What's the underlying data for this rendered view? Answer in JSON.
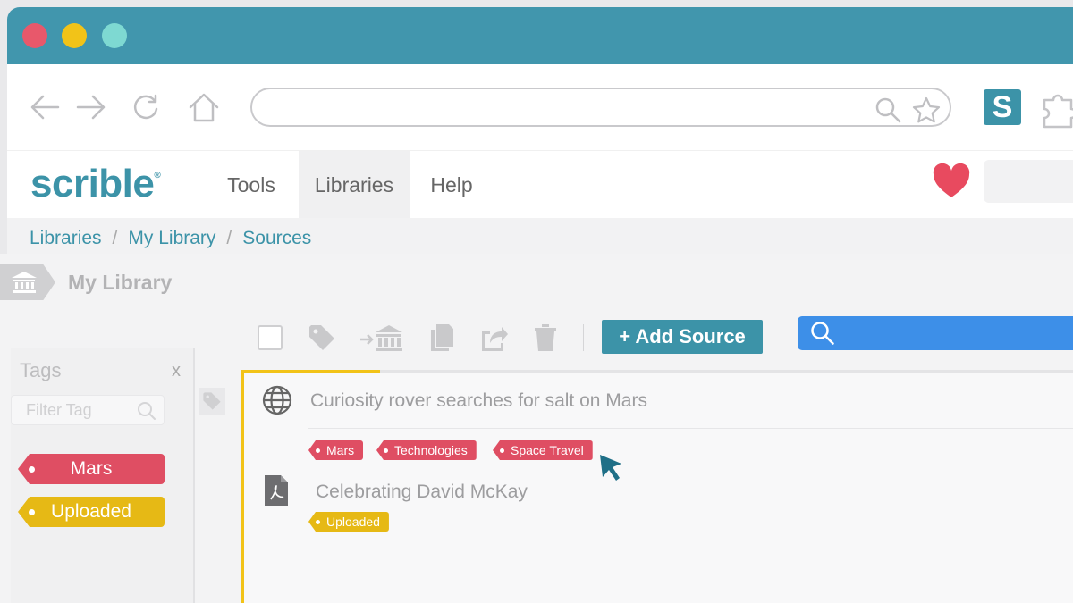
{
  "browser": {
    "colors": {
      "titlebar": "#4196ad",
      "close": "#e8586b",
      "minimize": "#f2c318",
      "maximize": "#7ed9d2"
    },
    "nav": {
      "back_icon": "arrow-left-icon",
      "forward_icon": "arrow-right-icon",
      "reload_icon": "reload-icon",
      "home_icon": "home-icon"
    },
    "address_bar": {
      "value": "",
      "search_icon": "search-icon",
      "star_icon": "star-icon"
    },
    "extensions": {
      "scrible_letter": "S",
      "puzzle_icon": "puzzle-icon"
    }
  },
  "app": {
    "logo": "scrible",
    "logo_mark": "®",
    "brand_color": "#3c93a8",
    "menu": {
      "tools": "Tools",
      "libraries": "Libraries",
      "help": "Help"
    },
    "heart_color": "#e84a5f"
  },
  "breadcrumb": {
    "items": [
      "Libraries",
      "My Library",
      "Sources"
    ],
    "separator": "/"
  },
  "library": {
    "title": "My Library",
    "icon": "bank-icon"
  },
  "actions": {
    "add_source": "+ Add Source",
    "icons": [
      "select-all-checkbox",
      "tag-icon",
      "move-to-library-icon",
      "copy-icon",
      "share-icon",
      "trash-icon"
    ]
  },
  "tags_panel": {
    "title": "Tags",
    "close": "x",
    "filter_placeholder": "Filter Tag",
    "tags": [
      {
        "label": "Mars",
        "color": "#df4e63"
      },
      {
        "label": "Uploaded",
        "color": "#e6b915"
      }
    ]
  },
  "sources": [
    {
      "icon": "globe-icon",
      "title": "Curiosity rover searches for salt on Mars",
      "tags": [
        "Mars",
        "Technologies",
        "Space Travel"
      ]
    },
    {
      "icon": "pdf-file-icon",
      "title": "Celebrating David McKay",
      "tags": [
        "Uploaded"
      ]
    }
  ]
}
